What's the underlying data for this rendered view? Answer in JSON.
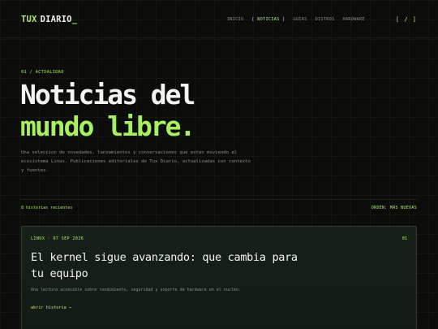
{
  "brand": {
    "name_part1": "TUX",
    "name_part2": "DIARIO",
    "cursor": "_"
  },
  "nav": {
    "items": [
      {
        "label": "INICIO",
        "active": false
      },
      {
        "label": "[ NOTICIAS ]",
        "active": true
      },
      {
        "label": "GUIAS",
        "active": false
      },
      {
        "label": "DISTROS",
        "active": false
      },
      {
        "label": "HARDWARE",
        "active": false
      }
    ],
    "menu_toggle": "[ / ]"
  },
  "hero": {
    "eyebrow": "01 / ACTUALIDAD",
    "title_line1": "Noticias del",
    "title_line2": "mundo libre.",
    "description": "Una seleccion de novedades, lanzamientos y conversaciones que estan moviendo el ecosistema Linux. Publicaciones editoriales de Tux Diario, actualizadas con contexto y fuentes."
  },
  "list": {
    "count_label": "8 historias recientes",
    "sort_label": "ORDEN: MAS NUEVAS"
  },
  "featured_card": {
    "meta": "LINUX · 07 SEP 2026",
    "number": "01",
    "title": "El kernel sigue avanzando: que cambia para tu equipo",
    "description": "Una lectura accesible sobre rendimiento, seguridad y soporte de hardware en el nucleo.",
    "link_label": "abrir historia",
    "link_icon": "arrow-right-icon"
  },
  "colors": {
    "accent": "#a8f060",
    "background": "#0c0d0b",
    "text": "#f4f4f2",
    "muted": "#8d8f8a"
  }
}
